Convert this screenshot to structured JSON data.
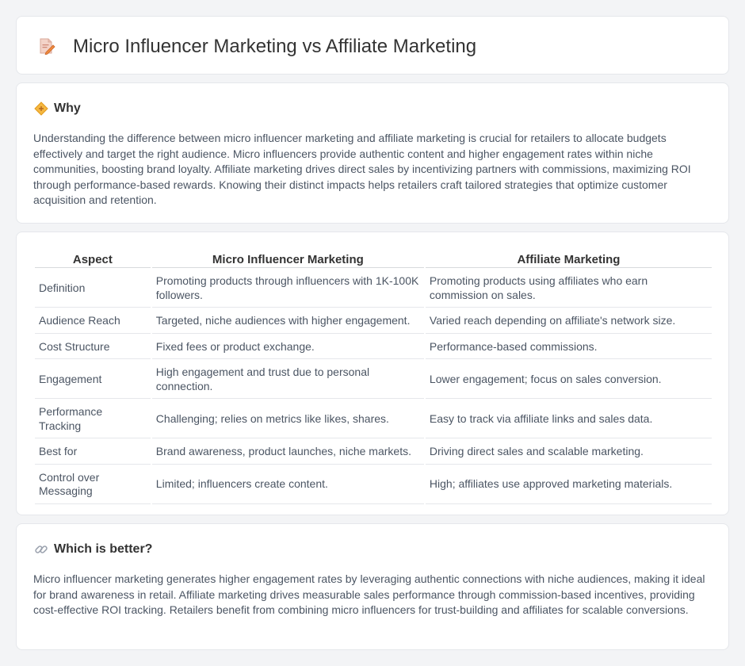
{
  "header": {
    "title": "Micro Influencer Marketing vs Affiliate Marketing",
    "icon": "document-pencil-icon"
  },
  "why": {
    "icon": "diamond-icon",
    "heading": "Why",
    "text": "Understanding the difference between micro influencer marketing and affiliate marketing is crucial for retailers to allocate budgets effectively and target the right audience. Micro influencers provide authentic content and higher engagement rates within niche communities, boosting brand loyalty. Affiliate marketing drives direct sales by incentivizing partners with commissions, maximizing ROI through performance-based rewards. Knowing their distinct impacts helps retailers craft tailored strategies that optimize customer acquisition and retention."
  },
  "comparison": {
    "headers": [
      "Aspect",
      "Micro Influencer Marketing",
      "Affiliate Marketing"
    ],
    "rows": [
      [
        "Definition",
        "Promoting products through influencers with 1K-100K followers.",
        "Promoting products using affiliates who earn commission on sales."
      ],
      [
        "Audience Reach",
        "Targeted, niche audiences with higher engagement.",
        "Varied reach depending on affiliate's network size."
      ],
      [
        "Cost Structure",
        "Fixed fees or product exchange.",
        "Performance-based commissions."
      ],
      [
        "Engagement",
        "High engagement and trust due to personal connection.",
        "Lower engagement; focus on sales conversion."
      ],
      [
        "Performance Tracking",
        "Challenging; relies on metrics like likes, shares.",
        "Easy to track via affiliate links and sales data."
      ],
      [
        "Best for",
        "Brand awareness, product launches, niche markets.",
        "Driving direct sales and scalable marketing."
      ],
      [
        "Control over Messaging",
        "Limited; influencers create content.",
        "High; affiliates use approved marketing materials."
      ]
    ]
  },
  "better": {
    "icon": "link-icon",
    "heading": "Which is better?",
    "text": "Micro influencer marketing generates higher engagement rates by leveraging authentic connections with niche audiences, making it ideal for brand awareness in retail. Affiliate marketing drives measurable sales performance through commission-based incentives, providing cost-effective ROI tracking. Retailers benefit from combining micro influencers for trust-building and affiliates for scalable conversions."
  }
}
